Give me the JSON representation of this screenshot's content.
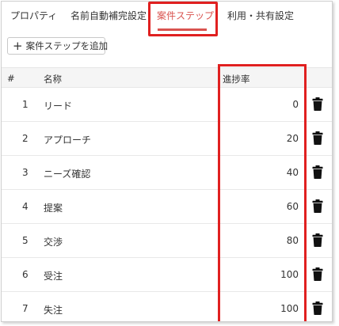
{
  "tabs": [
    {
      "label": "プロパティ"
    },
    {
      "label": "名前自動補完設定"
    },
    {
      "label": "案件ステップ"
    },
    {
      "label": "利用・共有設定"
    }
  ],
  "add_button": {
    "plus": "+",
    "label": "案件ステップを追加"
  },
  "table": {
    "headers": {
      "index": "#",
      "name": "名称",
      "rate": "進捗率"
    },
    "rows": [
      {
        "index": "1",
        "name": "リード",
        "rate": "0"
      },
      {
        "index": "2",
        "name": "アプローチ",
        "rate": "20"
      },
      {
        "index": "3",
        "name": "ニーズ確認",
        "rate": "40"
      },
      {
        "index": "4",
        "name": "提案",
        "rate": "60"
      },
      {
        "index": "5",
        "name": "交渉",
        "rate": "80"
      },
      {
        "index": "6",
        "name": "受注",
        "rate": "100"
      },
      {
        "index": "7",
        "name": "失注",
        "rate": "100"
      }
    ]
  },
  "colors": {
    "accent": "#d9534f",
    "highlight": "#e02020",
    "header_bg": "#f5f5f5"
  },
  "icons": {
    "row_action": "trash-icon"
  }
}
